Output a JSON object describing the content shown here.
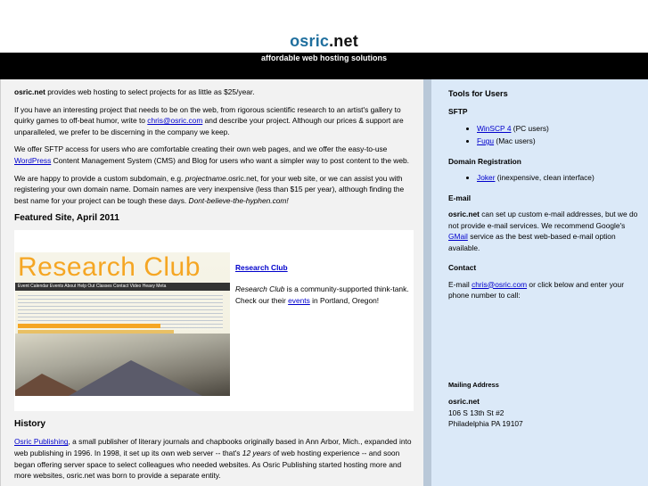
{
  "header": {
    "brand": "osric",
    "tld": ".net",
    "tagline": "affordable web hosting solutions"
  },
  "main": {
    "intro": {
      "strong": "osric.net",
      "text": " provides web hosting to select projects for as little as $25/year."
    },
    "p2": {
      "before": "If you have an interesting project that needs to be on the web, from rigorous scientific research to an artist's gallery to quirky games to off-beat humor, write to ",
      "link": "chris@osric.com",
      "after": " and describe your project. Although our prices & support are unparalleled, we prefer to be discerning in the company we keep."
    },
    "p3": {
      "before": "We offer SFTP access for users who are comfortable creating their own web pages, and we offer the easy-to-use ",
      "link": "WordPress",
      "after": " Content Management System (CMS) and Blog for users who want a simpler way to post content to the web."
    },
    "p4": {
      "before": "We are happy to provide a custom subdomain, e.g. ",
      "example": "projectname",
      "middle": ".osric.net, for your web site, or we can assist you with registering your own domain name. Domain names are very inexpensive (less than $15 per year), although finding the best name for your project can be tough these days. ",
      "closing": "Dont-believe-the-hyphen.com!"
    },
    "featured": {
      "heading": "Featured Site, April 2011",
      "link": "Research Club",
      "text_name": "Research Club",
      "text_before": " is a community-supported think-tank. Check our their ",
      "text_link": "events",
      "text_after": " in Portland, Oregon!",
      "image": {
        "title": "Research Club",
        "nav": "Event Calendar   Events   About   Help Out   Classes   Contact   Video   Heavy Meta"
      }
    },
    "history": {
      "heading": "History",
      "link": "Osric Publishing",
      "before_italic": ", a small publisher of literary journals and chapbooks originally based in Ann Arbor, Mich., expanded into web publishing in 1996. In 1998, it set up its own web server -- that's ",
      "italic": "12 years",
      "after_italic": " of web hosting experience -- and soon began offering server space to select colleagues who needed websites. As Osric Publishing started hosting more and more websites, osric.net was born to provide a separate entity."
    }
  },
  "sidebar": {
    "title": "Tools for Users",
    "sftp": {
      "heading": "SFTP",
      "items": [
        {
          "link": "WinSCP 4",
          "note": " (PC users)"
        },
        {
          "link": "Fugu",
          "note": " (Mac users)"
        }
      ]
    },
    "domain": {
      "heading": "Domain Registration",
      "items": [
        {
          "link": "Joker",
          "note": " (inexpensive, clean interface)"
        }
      ]
    },
    "email": {
      "heading": "E-mail",
      "strong": "osric.net",
      "before": " can set up custom e-mail addresses, but we do not provide e-mail services. We recommend Google's ",
      "link": "GMail",
      "after": " service as the best web-based e-mail option available."
    },
    "contact": {
      "heading": "Contact",
      "before": "E-mail ",
      "link": "chris@osric.com",
      "after": " or click below and enter your phone number to call:"
    },
    "mailing": {
      "heading": "Mailing Address",
      "name": "osric.net",
      "line1": "106 S 13th St #2",
      "line2": "Philadelphia PA 19107"
    }
  },
  "colors": {
    "brand": "#1f6f9e",
    "banner": "#000000",
    "main_bg": "#f2f2f2",
    "sidebar_bg": "#dbe9f8",
    "link": "#0000cc",
    "featured_title": "#f5a623"
  }
}
